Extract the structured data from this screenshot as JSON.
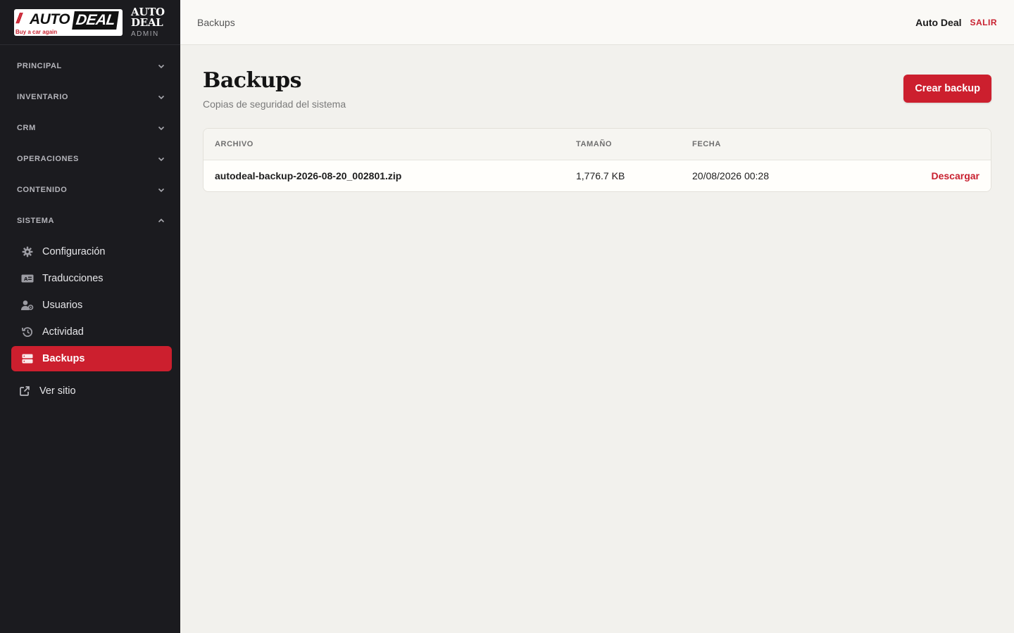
{
  "brand": {
    "logo_slash": "//",
    "logo_auto": "AUTO",
    "logo_deal": "DEAL",
    "logo_tagline": "Buy a car again",
    "name": "AUTO DEAL",
    "subtitle": "ADMIN"
  },
  "sidebar": {
    "groups": [
      {
        "label": "PRINCIPAL",
        "expanded": false
      },
      {
        "label": "INVENTARIO",
        "expanded": false
      },
      {
        "label": "CRM",
        "expanded": false
      },
      {
        "label": "OPERACIONES",
        "expanded": false
      },
      {
        "label": "CONTENIDO",
        "expanded": false
      },
      {
        "label": "SISTEMA",
        "expanded": true
      }
    ],
    "system_items": [
      {
        "label": "Configuración",
        "icon": "gear-icon"
      },
      {
        "label": "Traducciones",
        "icon": "language-icon"
      },
      {
        "label": "Usuarios",
        "icon": "users-icon"
      },
      {
        "label": "Actividad",
        "icon": "history-icon"
      },
      {
        "label": "Backups",
        "icon": "database-icon",
        "active": true
      }
    ],
    "view_site": {
      "label": "Ver sitio",
      "icon": "external-link-icon"
    }
  },
  "topbar": {
    "breadcrumb": "Backups",
    "user_name": "Auto Deal",
    "logout_label": "SALIR"
  },
  "page": {
    "title": "Backups",
    "subtitle": "Copias de seguridad del sistema",
    "create_button": "Crear backup"
  },
  "table": {
    "headers": {
      "file": "ARCHIVO",
      "size": "TAMAÑO",
      "date": "FECHA"
    },
    "rows": [
      {
        "file": "autodeal-backup-2026-08-20_002801.zip",
        "size": "1,776.7 KB",
        "date": "20/08/2026 00:28",
        "action": "Descargar"
      }
    ]
  },
  "colors": {
    "accent": "#cc1f2e",
    "sidebar_bg": "#1b1b1f",
    "page_bg": "#f2f1ed"
  }
}
